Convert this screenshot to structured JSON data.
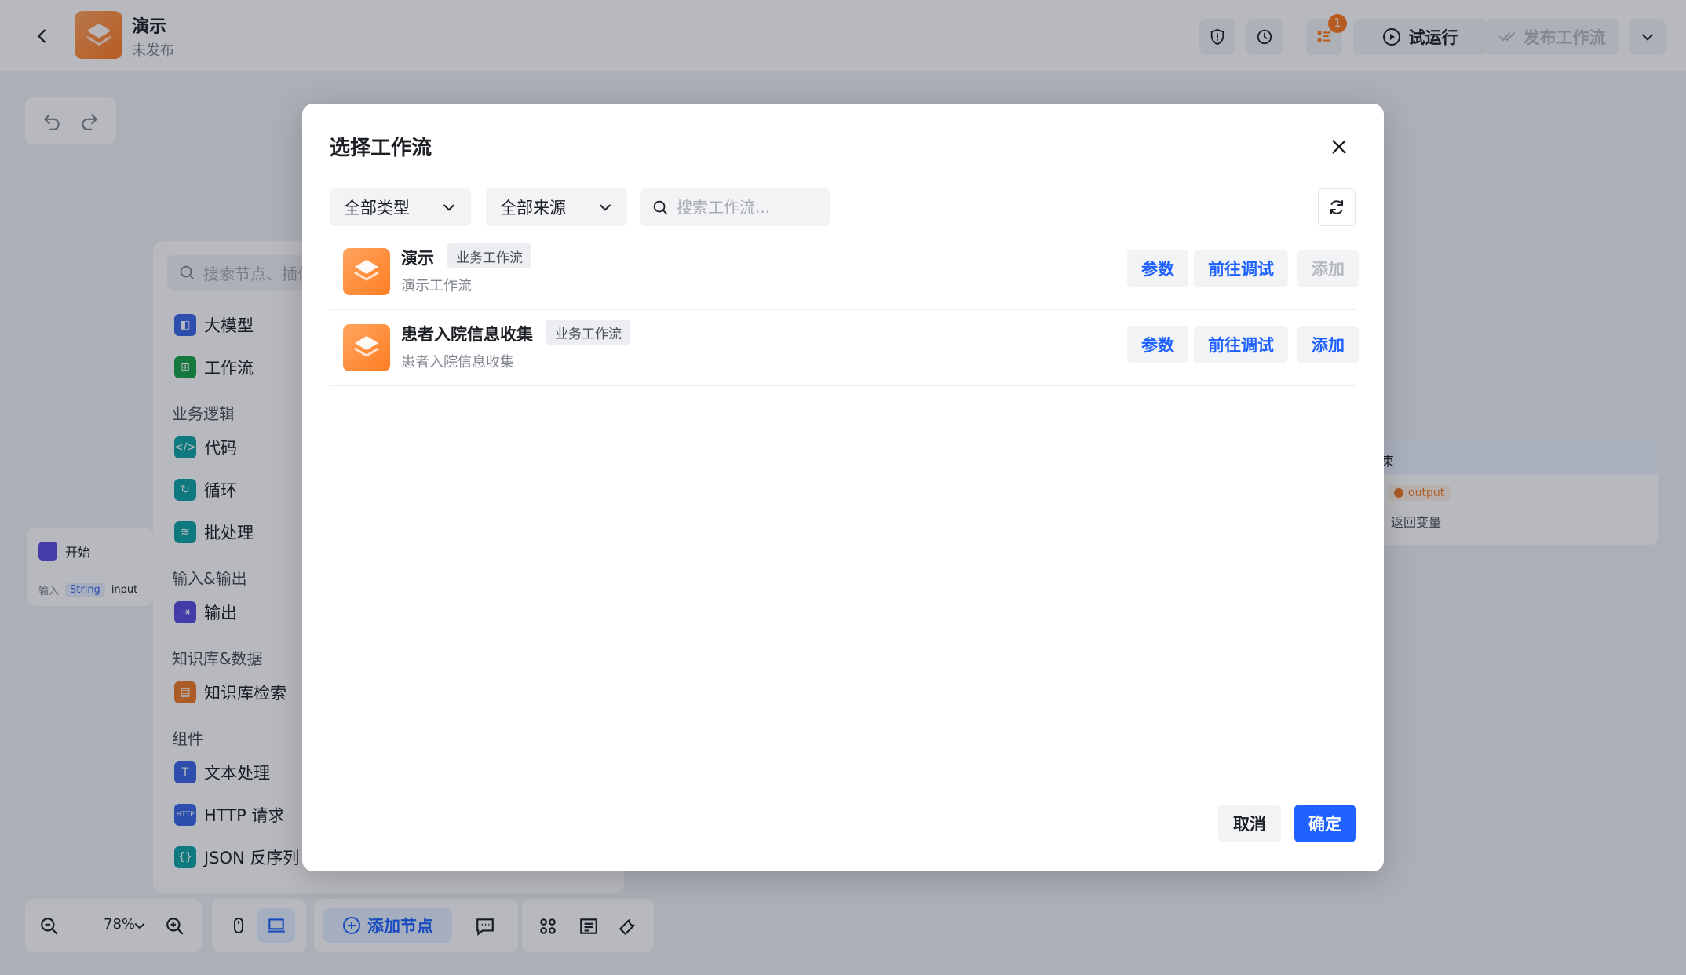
{
  "header": {
    "app_name": "演示",
    "app_status": "未发布",
    "notification_count": "1",
    "test_run_label": "试运行",
    "publish_label": "发布工作流"
  },
  "node_panel": {
    "search_placeholder": "搜索节点、插件",
    "items": [
      {
        "label": "大模型",
        "icon": "brain-icon",
        "color": "#1f62ff"
      },
      {
        "label": "工作流",
        "icon": "workflow-icon",
        "color": "#16a34a"
      },
      {
        "group": "业务逻辑"
      },
      {
        "label": "代码",
        "icon": "code-icon",
        "color": "#0ea5a5"
      },
      {
        "label": "循环",
        "icon": "loop-icon",
        "color": "#0ea5a5"
      },
      {
        "label": "批处理",
        "icon": "batch-icon",
        "color": "#0ea5a5"
      },
      {
        "group": "输入&输出"
      },
      {
        "label": "输出",
        "icon": "output-icon",
        "color": "#5b4de0"
      },
      {
        "group": "知识库&数据"
      },
      {
        "label": "知识库检索",
        "icon": "knowledge-icon",
        "color": "#f07a28"
      },
      {
        "group": "组件"
      },
      {
        "label": "文本处理",
        "icon": "text-icon",
        "color": "#3b66e8"
      },
      {
        "label": "HTTP 请求",
        "icon": "http-icon",
        "color": "#3b66e8"
      },
      {
        "label": "JSON 反序列",
        "icon": "json-icon",
        "color": "#0ea5a5"
      }
    ]
  },
  "canvas": {
    "start_node": {
      "title": "开始",
      "field_label": "输入",
      "field_type": "String",
      "field_name": "input"
    },
    "end_node": {
      "title": "束",
      "output_tag": "output",
      "output_desc": "返回变量"
    }
  },
  "bottombar": {
    "zoom": "78%",
    "add_node_label": "添加节点"
  },
  "modal": {
    "title": "选择工作流",
    "filter_type": "全部类型",
    "filter_source": "全部来源",
    "search_placeholder": "搜索工作流...",
    "workflows": [
      {
        "name": "演示",
        "tag": "业务工作流",
        "desc": "演示工作流",
        "params_label": "参数",
        "debug_label": "前往调试",
        "add_label": "添加",
        "add_disabled": true
      },
      {
        "name": "患者入院信息收集",
        "tag": "业务工作流",
        "desc": "患者入院信息收集",
        "params_label": "参数",
        "debug_label": "前往调试",
        "add_label": "添加",
        "add_disabled": false
      }
    ],
    "cancel_label": "取消",
    "confirm_label": "确定"
  },
  "colors": {
    "primary": "#1f62ff",
    "logo_orange": "#ff7d22"
  }
}
